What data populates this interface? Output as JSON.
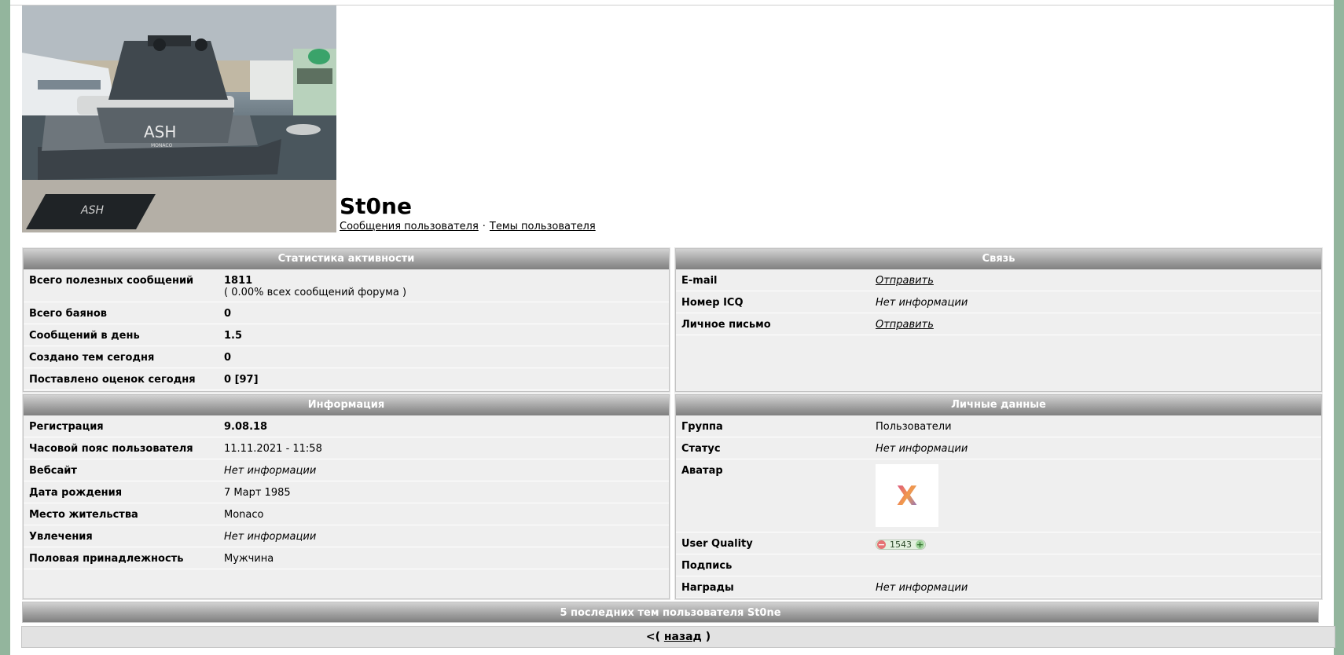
{
  "profile": {
    "username": "St0ne",
    "photo_label": "ASH",
    "photo_sublabel": "MONACO",
    "links": {
      "messages": "Сообщения пользователя",
      "separator": "·",
      "topics": "Темы пользователя"
    }
  },
  "activity": {
    "header": "Статистика активности",
    "rows": [
      {
        "label": "Всего полезных сообщений",
        "value": "1811",
        "sub": "( 0.00% всех сообщений форума )"
      },
      {
        "label": "Всего баянов",
        "value": "0"
      },
      {
        "label": "Сообщений в день",
        "value": "1.5"
      },
      {
        "label": "Создано тем сегодня",
        "value": "0"
      },
      {
        "label": "Поставлено оценок сегодня",
        "value": "0 [97]"
      }
    ]
  },
  "contact": {
    "header": "Связь",
    "rows": [
      {
        "label": "E-mail",
        "value": "Отправить"
      },
      {
        "label": "Номер ICQ",
        "value": "Нет информации"
      },
      {
        "label": "Личное письмо",
        "value": "Отправить"
      }
    ]
  },
  "info": {
    "header": "Информация",
    "rows": [
      {
        "label": "Регистрация",
        "value": "9.08.18"
      },
      {
        "label": "Часовой пояс пользователя",
        "value": "11.11.2021 - 11:58"
      },
      {
        "label": "Вебсайт",
        "value": "Нет информации"
      },
      {
        "label": "Дата рождения",
        "value": "7 Март 1985"
      },
      {
        "label": "Место жительства",
        "value": "Monaco"
      },
      {
        "label": "Увлечения",
        "value": "Нет информации"
      },
      {
        "label": "Половая принадлежность",
        "value": "Мужчина"
      }
    ]
  },
  "personal": {
    "header": "Личные данные",
    "rows": [
      {
        "label": "Группа",
        "value": "Пользователи"
      },
      {
        "label": "Статус",
        "value": "Нет информации"
      },
      {
        "label": "Аватар",
        "avatar_letter": "X"
      },
      {
        "label": "User Quality",
        "minus": "−",
        "score": "1543",
        "plus": "+"
      },
      {
        "label": "Подпись",
        "value": ""
      },
      {
        "label": "Награды",
        "value": "Нет информации"
      }
    ]
  },
  "recent_topics": {
    "header": "5 последних тем пользователя St0ne"
  },
  "back": {
    "prefix": "<(",
    "link": "назад",
    "suffix": ")"
  },
  "colors": {
    "side_background": "#93b59d",
    "header_gradient_top": "#d2d2d2",
    "header_gradient_bottom": "#7f7f7f",
    "row_background": "#efefef"
  }
}
